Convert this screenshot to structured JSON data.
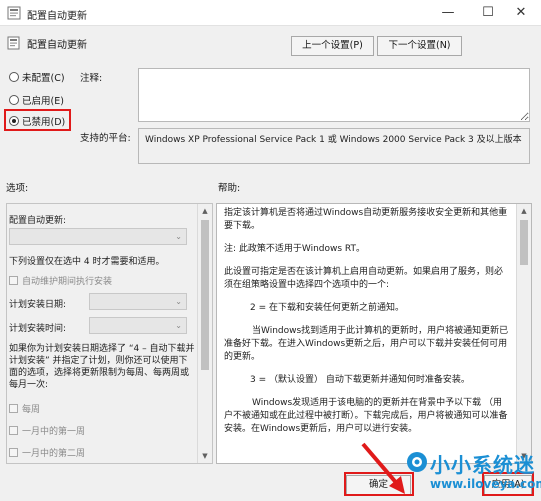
{
  "window": {
    "title": "配置自动更新",
    "minimize_glyph": "—",
    "maximize_glyph": "☐",
    "close_glyph": "✕"
  },
  "header": {
    "title": "配置自动更新",
    "prev_button": "上一个设置(P)",
    "next_button": "下一个设置(N)"
  },
  "state": {
    "options": [
      {
        "label": "未配置(C)",
        "selected": false
      },
      {
        "label": "已启用(E)",
        "selected": false
      },
      {
        "label": "已禁用(D)",
        "selected": true
      }
    ],
    "highlight_color": "#e01a1a"
  },
  "comment": {
    "label": "注释:",
    "value": ""
  },
  "platform": {
    "label": "支持的平台:",
    "value": "Windows XP Professional Service Pack 1 或 Windows 2000 Service Pack 3 及以上版本"
  },
  "options_pane": {
    "label": "选项:",
    "configure_label": "配置自动更新:",
    "apply_note": "下列设置仅在选中 4 时才需要和适用。",
    "maintenance_checkbox": "自动维护期间执行安装",
    "schedule_day_label": "计划安装日期:",
    "schedule_time_label": "计划安装时间:",
    "long_text": "如果你为计划安装日期选择了 “4 – 自动下载并计划安装” 并指定了计划，则你还可以使用下面的选项，选择将更新限制为每周、每两周或每月一次:",
    "every_week": "每周",
    "first_week": "一月中的第一周",
    "second_week": "一月中的第二周"
  },
  "help_pane": {
    "label": "帮助:",
    "paragraphs": [
      "指定该计算机是否将通过Windows自动更新服务接收安全更新和其他重要下载。",
      "注: 此政策不适用于Windows RT。",
      "此设置可指定是否在该计算机上启用自动更新。如果启用了服务，则必须在组策略设置中选择四个选项中的一个:",
      "2 = 在下载和安装任何更新之前通知。",
      "当Windows找到适用于此计算机的更新时，用户将被通知更新已准备好下载。在进入Windows更新之后，用户可以下载并安装任何可用的更新。",
      "3 = （默认设置） 自动下载更新并通知何时准备安装。",
      "Windows发现适用于该电脑的的更新并在背景中予以下载 （用户不被通知或在此过程中被打断）。下载完成后，用户将被通知可以准备安装。在Windows更新后，用户可以进行安装。"
    ]
  },
  "footer": {
    "ok_button": "确定",
    "apply_button": "应用(A)"
  },
  "watermark": {
    "brand": "小小系统迷",
    "url": "www.iloveya.com",
    "color": "#1b8fd4"
  }
}
